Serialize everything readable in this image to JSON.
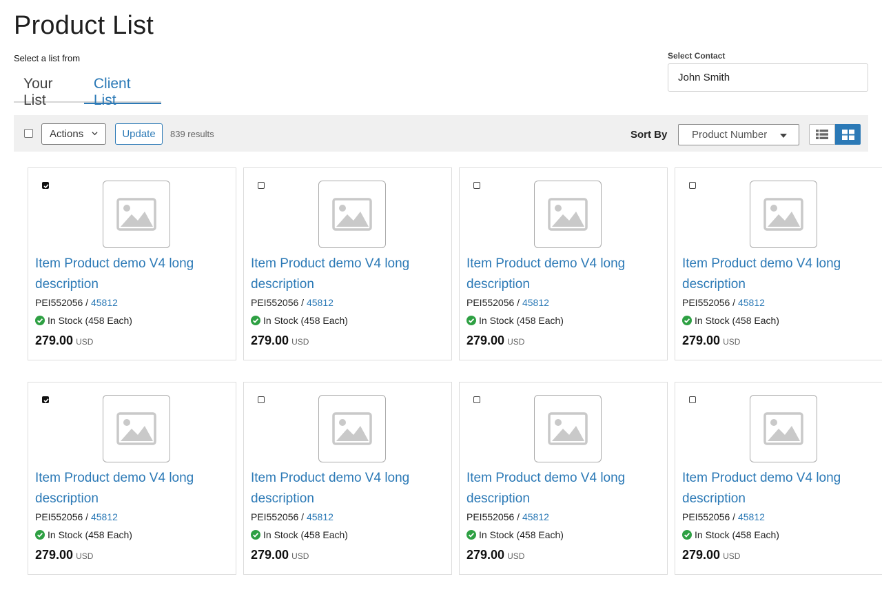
{
  "page": {
    "title": "Product List"
  },
  "list_selector": {
    "label": "Select a list from",
    "tabs": [
      {
        "label": "Your List",
        "active": false
      },
      {
        "label": "Client List",
        "active": true
      }
    ]
  },
  "contact": {
    "label": "Select Contact",
    "value": "John Smith"
  },
  "toolbar": {
    "actions_label": "Actions",
    "update_label": "Update",
    "results_text": "839 results",
    "sort_label": "Sort By",
    "sort_value": "Product Number",
    "view_mode": "grid"
  },
  "colors": {
    "accent": "#2b79b6",
    "in_stock": "#2ea043",
    "toolbar_bg": "#f0f0f0"
  },
  "products": [
    {
      "checked": true,
      "title": "Item Product demo V4 long description",
      "sku": "PEI552056",
      "sep": " / ",
      "part": "45812",
      "stock": "In Stock (458 Each)",
      "price": "279.00",
      "currency": "USD"
    },
    {
      "checked": false,
      "title": "Item Product demo V4 long description",
      "sku": "PEI552056",
      "sep": " / ",
      "part": "45812",
      "stock": "In Stock (458 Each)",
      "price": "279.00",
      "currency": "USD"
    },
    {
      "checked": false,
      "title": "Item Product demo V4 long description",
      "sku": "PEI552056",
      "sep": " / ",
      "part": "45812",
      "stock": "In Stock (458 Each)",
      "price": "279.00",
      "currency": "USD"
    },
    {
      "checked": false,
      "title": "Item Product demo V4 long description",
      "sku": "PEI552056",
      "sep": " / ",
      "part": "45812",
      "stock": "In Stock (458 Each)",
      "price": "279.00",
      "currency": "USD"
    },
    {
      "checked": true,
      "title": "Item Product demo V4 long description",
      "sku": "PEI552056",
      "sep": " / ",
      "part": "45812",
      "stock": "In Stock (458 Each)",
      "price": "279.00",
      "currency": "USD"
    },
    {
      "checked": false,
      "title": "Item Product demo V4 long description",
      "sku": "PEI552056",
      "sep": " / ",
      "part": "45812",
      "stock": "In Stock (458 Each)",
      "price": "279.00",
      "currency": "USD"
    },
    {
      "checked": false,
      "title": "Item Product demo V4 long description",
      "sku": "PEI552056",
      "sep": " / ",
      "part": "45812",
      "stock": "In Stock (458 Each)",
      "price": "279.00",
      "currency": "USD"
    },
    {
      "checked": false,
      "title": "Item Product demo V4 long description",
      "sku": "PEI552056",
      "sep": " / ",
      "part": "45812",
      "stock": "In Stock (458 Each)",
      "price": "279.00",
      "currency": "USD"
    }
  ]
}
